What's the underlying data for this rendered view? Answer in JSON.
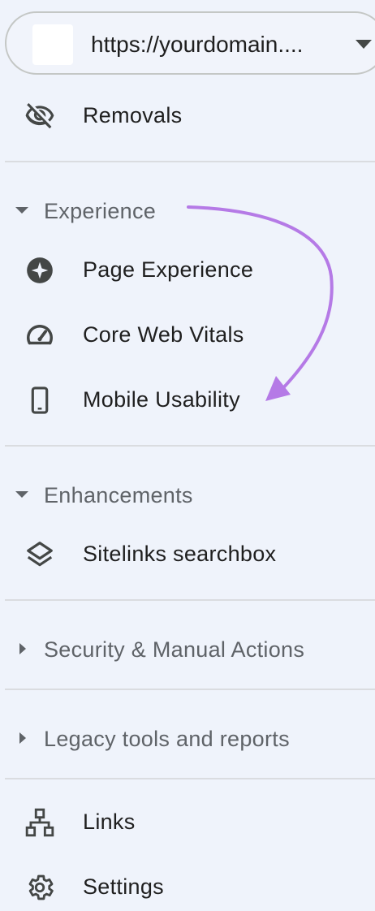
{
  "property": {
    "url": "https://yourdomain...."
  },
  "nav": {
    "removals": "Removals",
    "experience_section": "Experience",
    "page_experience": "Page Experience",
    "core_web_vitals": "Core Web Vitals",
    "mobile_usability": "Mobile Usability",
    "enhancements_section": "Enhancements",
    "sitelinks_searchbox": "Sitelinks searchbox",
    "security_section": "Security & Manual Actions",
    "legacy_section": "Legacy tools and reports",
    "links": "Links",
    "settings": "Settings"
  },
  "colors": {
    "background": "#eff3fb",
    "annotation_arrow": "#b57ae6",
    "icon": "#444746",
    "section_text": "#5f6368"
  },
  "icons": {
    "removals": "eye-off-icon",
    "page_experience": "star-badge-icon",
    "core_web_vitals": "speedometer-icon",
    "mobile_usability": "smartphone-icon",
    "sitelinks_searchbox": "layers-icon",
    "links": "network-icon",
    "settings": "gear-icon"
  }
}
